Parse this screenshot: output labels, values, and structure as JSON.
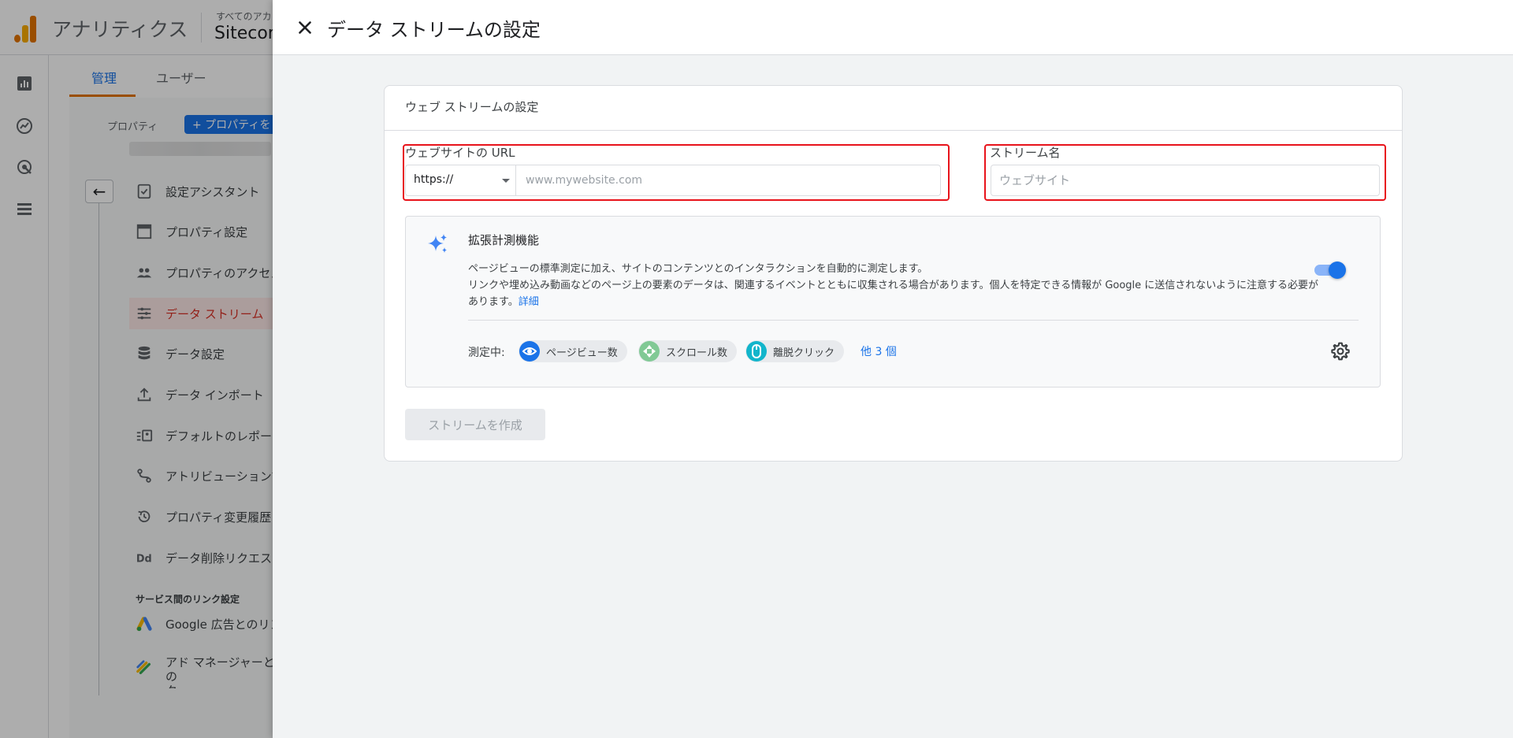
{
  "app": {
    "name": "アナリティクス",
    "account_sub": "すべてのアカ",
    "account_name": "Sitecor"
  },
  "admin": {
    "tabs": [
      {
        "label": "管理",
        "active": true
      },
      {
        "label": "ユーザー",
        "active": false
      }
    ],
    "property_label": "プロパティ",
    "property_button": "+ プロパティを",
    "menu": [
      {
        "label": "設定アシスタント",
        "icon": "checklist-icon"
      },
      {
        "label": "プロパティ設定",
        "icon": "property-settings-icon"
      },
      {
        "label": "プロパティのアクセス",
        "icon": "people-icon"
      },
      {
        "label": "データ ストリーム",
        "icon": "data-stream-icon",
        "active": true
      },
      {
        "label": "データ設定",
        "icon": "database-icon"
      },
      {
        "label": "データ インポート",
        "icon": "upload-icon"
      },
      {
        "label": "デフォルトのレポート",
        "icon": "report-identity-icon"
      },
      {
        "label": "アトリビューション設",
        "icon": "attribution-icon"
      },
      {
        "label": "プロパティ変更履歴",
        "icon": "history-icon"
      },
      {
        "label": "データ削除リクエスト",
        "icon": "data-deletion-icon"
      }
    ],
    "links_section": "サービス間のリンク設定",
    "links": [
      {
        "label": "Google 広告とのリン",
        "icon": "google-ads-icon"
      },
      {
        "label": "アド マネージャーとの",
        "label2": "ク",
        "icon": "ad-manager-icon"
      }
    ]
  },
  "panel": {
    "title": "データ ストリームの設定",
    "card_title": "ウェブ ストリームの設定",
    "url_label": "ウェブサイトの URL",
    "protocol_value": "https://",
    "url_placeholder": "www.mywebsite.com",
    "name_label": "ストリーム名",
    "name_placeholder": "ウェブサイト",
    "enhanced": {
      "title": "拡張計測機能",
      "desc_line1": "ページビューの標準測定に加え、サイトのコンテンツとのインタラクションを自動的に測定します。",
      "desc_line2": "リンクや埋め込み動画などのページ上の要素のデータは、関連するイベントとともに収集される場合があります。個人を特定できる情報が Google に送信されないように注意する必要があります。",
      "details_link": "詳細",
      "toggle_on": true,
      "measuring_label": "測定中:",
      "chips": [
        {
          "label": "ページビュー数",
          "icon": "eye-icon",
          "color": "#1a73e8"
        },
        {
          "label": "スクロール数",
          "icon": "scroll-icon",
          "color": "#81c995"
        },
        {
          "label": "離脱クリック",
          "icon": "mouse-icon",
          "color": "#12b5cb"
        }
      ],
      "more_link": "他 3 個"
    },
    "create_button": "ストリームを作成"
  },
  "colors": {
    "accent": "#1a73e8",
    "highlight": "#e8131b",
    "active_menu": "#d93025",
    "tab_underline": "#e37400"
  }
}
